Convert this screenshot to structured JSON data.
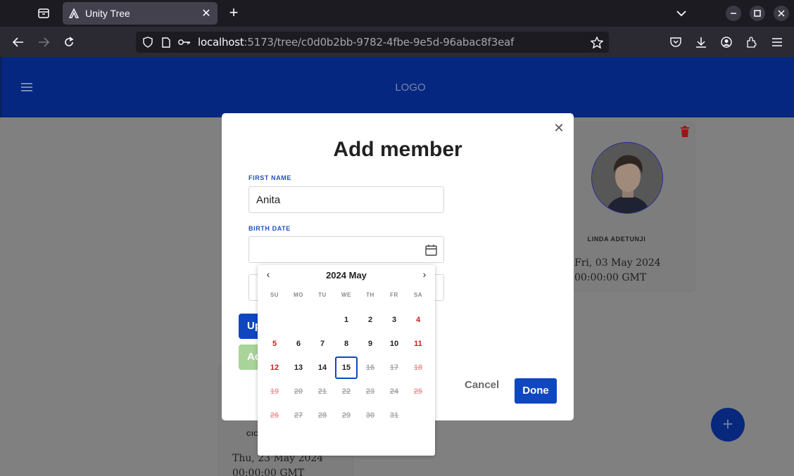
{
  "browser": {
    "tab_title": "Unity Tree",
    "url_host": "localhost",
    "url_path": ":5173/tree/c0d0b2bb-9782-4fbe-9e5d-96abac8f3eaf"
  },
  "app": {
    "logo": "LOGO"
  },
  "cards": {
    "right": {
      "name": "LINDA ADETUNJI",
      "date_line1": "Fri, 03 May 2024",
      "date_line2": "00:00:00 GMT"
    },
    "bottom": {
      "name": "CIC",
      "date_line1": "Thu, 23 May 2024",
      "date_line2": "00:00:00 GMT"
    }
  },
  "modal": {
    "title": "Add member",
    "first_name_label": "FIRST NAME",
    "first_name_value": "Anita",
    "birth_date_label": "BIRTH DATE",
    "birth_date_value": "",
    "update_btn_partial": "Up",
    "add_btn_partial": "Ac",
    "cancel_label": "Cancel",
    "done_label": "Done"
  },
  "calendar": {
    "header": "2024 May",
    "weekdays": [
      "SU",
      "MO",
      "TU",
      "WE",
      "TH",
      "FR",
      "SA"
    ],
    "first_weekday_index": 3,
    "days_in_month": 31,
    "today": 15
  },
  "colors": {
    "header_blue": "#06277f",
    "primary": "#0f47c0",
    "weekend_red": "#d11b1b"
  }
}
